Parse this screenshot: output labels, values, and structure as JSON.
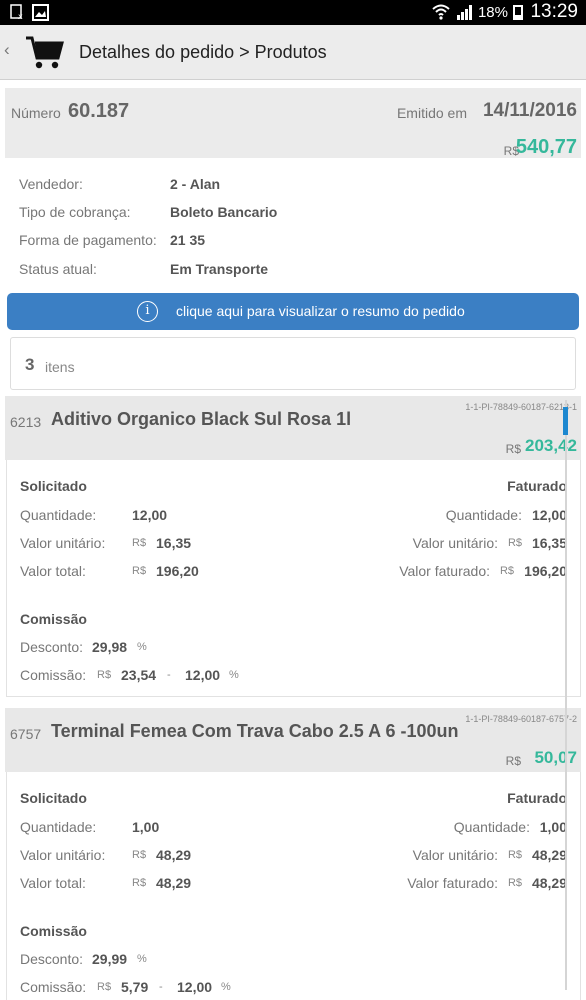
{
  "status": {
    "battery": "18%",
    "time": "13:29"
  },
  "actionbar": {
    "title": "Detalhes do pedido > Produtos"
  },
  "pedido": {
    "numero_label": "Número",
    "numero": "60.187",
    "emitido_label": "Emitido em",
    "emitido": "14/11/2016",
    "currency": "R$",
    "total": "540,77"
  },
  "info": {
    "vendedor_label": "Vendedor:",
    "vendedor": "2 - Alan",
    "tipo_label": "Tipo de cobrança:",
    "tipo": "Boleto Bancario",
    "forma_label": "Forma de pagamento:",
    "forma": "21 35",
    "status_label": "Status atual:",
    "status": "Em Transporte"
  },
  "resumo_button": "clique aqui para visualizar o resumo do pedido",
  "itens": {
    "count": "3",
    "label": "itens"
  },
  "products": [
    {
      "code": "6213",
      "name": "Aditivo Organico Black Sul Rosa 1l",
      "ref": "1-1-PI-78849-60187-6213-1",
      "currency": "R$",
      "value": "203,42",
      "solicitado_label": "Solicitado",
      "faturado_label": "Faturado",
      "quantidade_label": "Quantidade:",
      "quantidade": "12,00",
      "quantidade_fat": "12,00",
      "unit_label": "Valor unitário:",
      "unit": "16,35",
      "unit_fat": "16,35",
      "total_label": "Valor total:",
      "total": "196,20",
      "faturado_val_label": "Valor faturado:",
      "faturado_val": "196,20",
      "comissao_title": "Comissão",
      "desconto_label": "Desconto:",
      "desconto": "29,98",
      "pct": "%",
      "comissao_label": "Comissão:",
      "comissao": "23,54",
      "dash": "-",
      "comissao_pct": "12,00"
    },
    {
      "code": "6757",
      "name": "Terminal Femea Com Trava Cabo 2.5 A 6 -100un",
      "ref": "1-1-PI-78849-60187-6757-2",
      "currency": "R$",
      "value": "50,07",
      "solicitado_label": "Solicitado",
      "faturado_label": "Faturado",
      "quantidade_label": "Quantidade:",
      "quantidade": "1,00",
      "quantidade_fat": "1,00",
      "unit_label": "Valor unitário:",
      "unit": "48,29",
      "unit_fat": "48,29",
      "total_label": "Valor total:",
      "total": "48,29",
      "faturado_val_label": "Valor faturado:",
      "faturado_val": "48,29",
      "comissao_title": "Comissão",
      "desconto_label": "Desconto:",
      "desconto": "29,99",
      "pct": "%",
      "comissao_label": "Comissão:",
      "comissao": "5,79",
      "dash": "-",
      "comissao_pct": "12,00"
    }
  ],
  "colors": {
    "accent": "#3b7fc4",
    "value": "#35b89b",
    "scroll": "#1d88d0"
  }
}
